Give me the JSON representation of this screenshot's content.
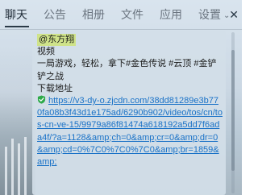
{
  "tabs": [
    {
      "label": "聊天",
      "active": true
    },
    {
      "label": "公告",
      "active": false
    },
    {
      "label": "相册",
      "active": false
    },
    {
      "label": "文件",
      "active": false
    },
    {
      "label": "应用",
      "active": false
    },
    {
      "label": "设置",
      "active": false,
      "has_dropdown": true
    }
  ],
  "close_icon": "✕",
  "message": {
    "mention": "@东方翔",
    "lines": [
      "视频",
      "一局游戏，轻松，拿下#金色传说 #云顶 #金铲铲之战",
      "下载地址"
    ],
    "link_text": "https://v3-dy-o.zjcdn.com/38dd81289e3b770fa08b3f43d1e175ad/6290b902/video/tos/cn/tos-cn-ve-15/9979a86f81474a618192a5dd7f6ada4f/?a=1128&amp;ch=0&amp;cr=0&amp;dr=0&amp;cd=0%7C0%7C0%7C0&amp;br=1859&amp;"
  },
  "colors": {
    "mention_highlight": "#cfe38a",
    "link": "#1a72c7",
    "shield": "#2eaa4a"
  },
  "icons": {
    "shield": "shield-check-icon",
    "dropdown": "chevron-down-icon",
    "close": "close-icon"
  }
}
